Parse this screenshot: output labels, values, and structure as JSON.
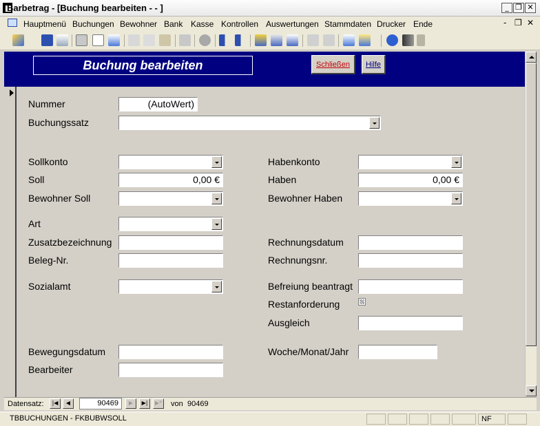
{
  "window": {
    "title": "Barbetrag - [Buchung bearbeiten - - ]",
    "controls": {
      "minimize": "_",
      "restore": "❐",
      "close": "✕",
      "mdi_minimize": "-",
      "mdi_restore": "❐",
      "mdi_close": "✕"
    }
  },
  "menu": {
    "items": [
      "Hauptmenü",
      "Buchungen",
      "Bewohner",
      "Bank",
      "Kasse",
      "Kontrollen",
      "Auswertungen",
      "Stammdaten",
      "Drucker",
      "Ende"
    ]
  },
  "toolbar": {
    "icons": [
      "design-view-icon",
      "save-icon",
      "search-file-icon",
      "print-icon",
      "print-preview-icon",
      "spellcheck-icon",
      "cut-icon",
      "copy-icon",
      "paste-icon",
      "undo-icon",
      "hyperlink-icon",
      "sort-ascending-icon",
      "sort-descending-icon",
      "filter-by-selection-icon",
      "filter-by-form-icon",
      "apply-filter-icon",
      "new-record-icon",
      "delete-record-icon",
      "database-window-icon",
      "new-object-icon",
      "help-icon",
      "find-icon"
    ]
  },
  "form": {
    "title": "Buchung bearbeiten",
    "close_button": "Schließen",
    "help_button": "Hilfe",
    "fields": {
      "nummer": {
        "label": "Nummer",
        "value": "(AutoWert)"
      },
      "buchungssatz": {
        "label": "Buchungssatz",
        "value": ""
      },
      "sollkonto": {
        "label": "Sollkonto",
        "value": ""
      },
      "soll": {
        "label": "Soll",
        "value": "0,00 €"
      },
      "bewohner_soll": {
        "label": "Bewohner Soll",
        "value": ""
      },
      "art": {
        "label": "Art",
        "value": ""
      },
      "zusatzbezeichnung": {
        "label": "Zusatzbezeichnung",
        "value": ""
      },
      "beleg_nr": {
        "label": "Beleg-Nr.",
        "value": ""
      },
      "sozialamt": {
        "label": "Sozialamt",
        "value": ""
      },
      "bewegungsdatum": {
        "label": "Bewegungsdatum",
        "value": ""
      },
      "bearbeiter": {
        "label": "Bearbeiter",
        "value": ""
      },
      "habenkonto": {
        "label": "Habenkonto",
        "value": ""
      },
      "haben": {
        "label": "Haben",
        "value": "0,00 €"
      },
      "bewohner_haben": {
        "label": "Bewohner Haben",
        "value": ""
      },
      "rechnungsdatum": {
        "label": "Rechnungsdatum",
        "value": ""
      },
      "rechnungsnr": {
        "label": "Rechnungsnr.",
        "value": ""
      },
      "befreiung_beantragt": {
        "label": "Befreiung beantragt",
        "value": ""
      },
      "restanforderung": {
        "label": "Restanforderung",
        "checked": false
      },
      "ausgleich": {
        "label": "Ausgleich",
        "value": ""
      },
      "woche_monat_jahr": {
        "label": "Woche/Monat/Jahr",
        "value": ""
      }
    }
  },
  "navigation": {
    "label": "Datensatz:",
    "current_record": "90469",
    "of_label": "von",
    "total_records": "90469",
    "buttons": {
      "first": "|◀",
      "prev": "◀",
      "next": "▶",
      "last": "▶|",
      "new": "▶*"
    }
  },
  "statusbar": {
    "text": "TBBUCHUNGEN - FKBUBWSOLL",
    "indicator": "NF"
  }
}
